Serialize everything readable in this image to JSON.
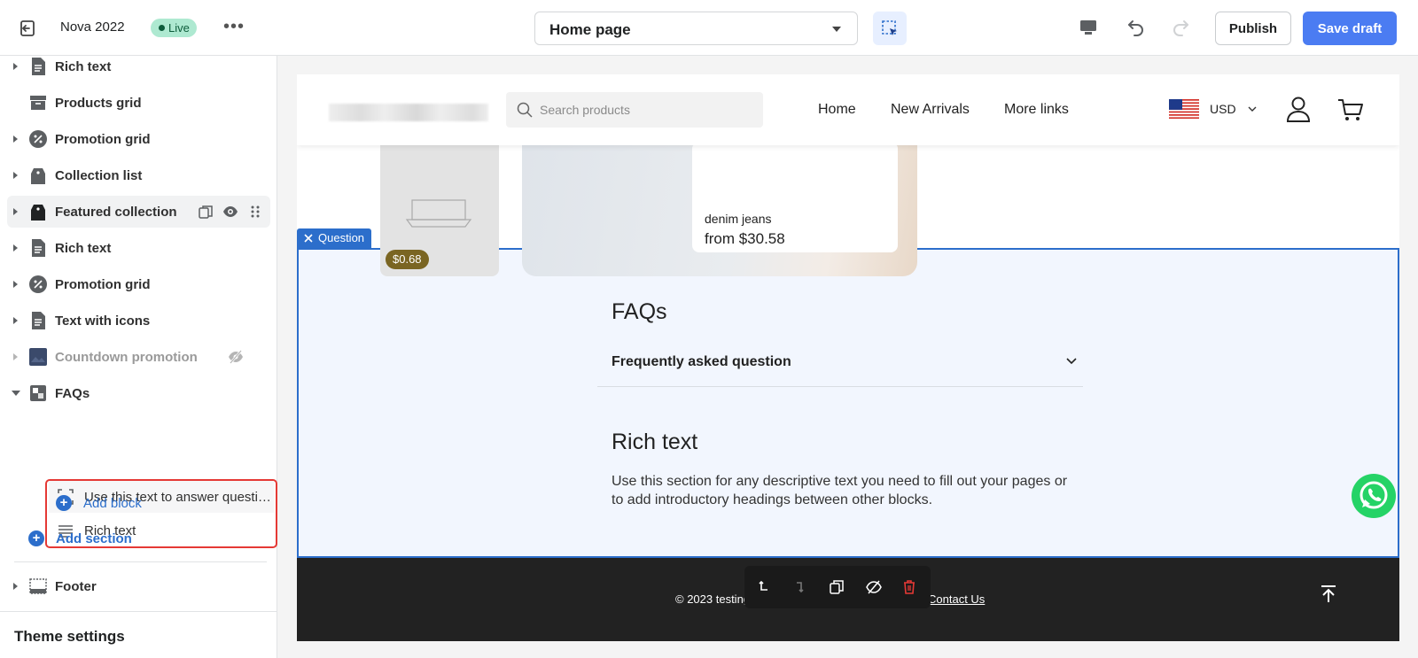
{
  "topbar": {
    "store_name": "Nova 2022",
    "live_badge": "Live",
    "more": "•••",
    "page_select": "Home page",
    "publish": "Publish",
    "save_draft": "Save draft"
  },
  "sidebar": {
    "sections": [
      {
        "label": "Rich text",
        "icon": "document-icon"
      },
      {
        "label": "Products grid",
        "icon": "archive-icon"
      },
      {
        "label": "Promotion grid",
        "icon": "discount-icon"
      },
      {
        "label": "Collection list",
        "icon": "tag-icon"
      },
      {
        "label": "Featured collection",
        "icon": "tag-icon"
      },
      {
        "label": "Rich text",
        "icon": "document-icon"
      },
      {
        "label": "Promotion grid",
        "icon": "discount-icon"
      },
      {
        "label": "Text with icons",
        "icon": "document-icon"
      },
      {
        "label": "Countdown promotion",
        "icon": "image-icon"
      },
      {
        "label": "FAQs",
        "icon": "faq-icon"
      }
    ],
    "blocks": [
      {
        "label": "Use this text to answer questi…",
        "icon": "dashed-square-icon"
      },
      {
        "label": "Rich text",
        "icon": "text-lines-icon"
      }
    ],
    "add_block": "Add block",
    "add_section": "Add section",
    "footer": "Footer",
    "theme_settings": "Theme settings"
  },
  "preview": {
    "search_placeholder": "Search products",
    "nav": [
      "Home",
      "New Arrivals",
      "More links"
    ],
    "currency": "USD",
    "card1_price": "$0.68",
    "card2_name": "denim jeans",
    "card2_price": "from $30.58",
    "question_tag": "Question",
    "faq_title": "FAQs",
    "faq_question": "Frequently asked question",
    "rich_text_title": "Rich text",
    "rich_text_body": "Use this section for any descriptive text you need to fill out your pages or to add introductory headings between other blocks.",
    "footer_copy": "© 2023 testing",
    "footer_contact": "Contact Us"
  },
  "colors": {
    "accent": "#4b7cf2",
    "link": "#2c6ecb",
    "live_bg": "#aee9d1",
    "highlight_border": "#e53935",
    "delete": "#e53935",
    "whatsapp": "#25d366"
  }
}
